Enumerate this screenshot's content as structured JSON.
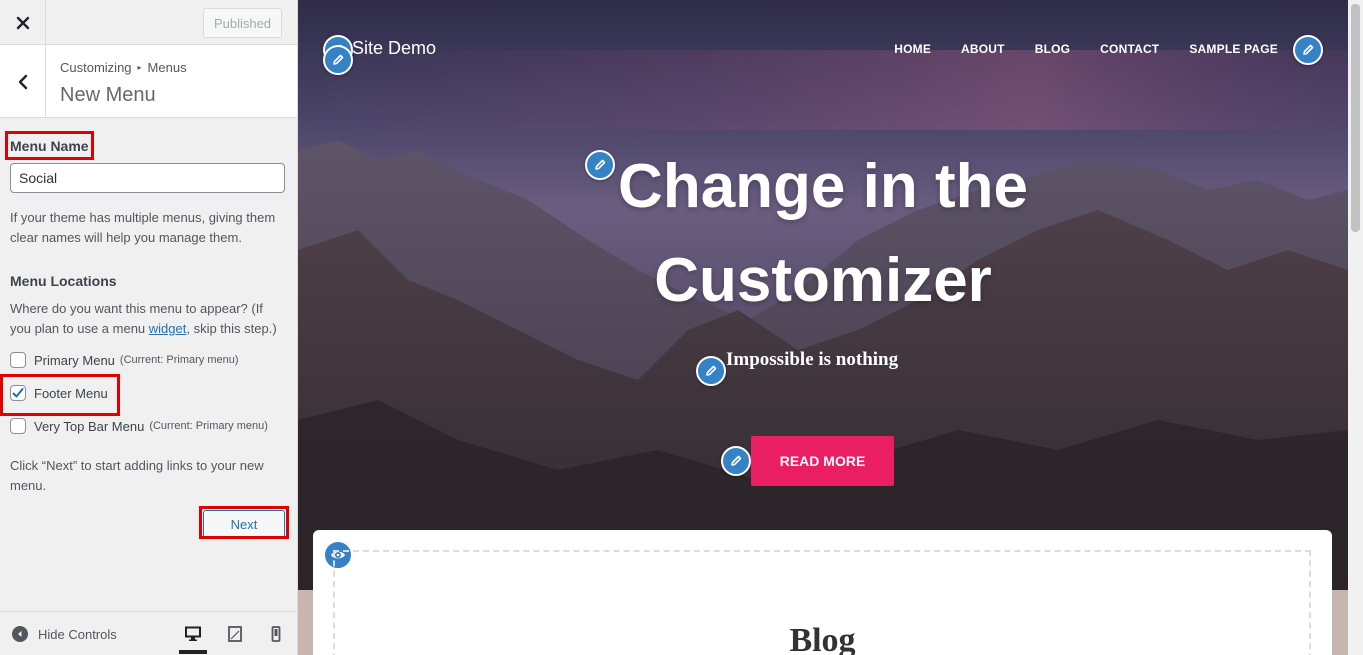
{
  "sidebar": {
    "published_label": "Published",
    "breadcrumb": {
      "root": "Customizing",
      "section": "Menus"
    },
    "panel_title": "New Menu",
    "menu_name": {
      "label": "Menu Name",
      "value": "Social",
      "description": "If your theme has multiple menus, giving them clear names will help you manage them."
    },
    "menu_locations": {
      "label": "Menu Locations",
      "description_before": "Where do you want this menu to appear? (If you plan to use a menu ",
      "description_link": "widget",
      "description_after": ", skip this step.)",
      "options": [
        {
          "label": "Primary Menu",
          "current": "(Current: Primary menu)",
          "checked": false
        },
        {
          "label": "Footer Menu",
          "current": "",
          "checked": true
        },
        {
          "label": "Very Top Bar Menu",
          "current": "(Current: Primary menu)",
          "checked": false
        }
      ]
    },
    "next_hint": "Click “Next” to start adding links to your new menu.",
    "next_label": "Next",
    "footer": {
      "hide_controls_label": "Hide Controls"
    }
  },
  "preview": {
    "site_title": "Site Demo",
    "nav": [
      "HOME",
      "ABOUT",
      "BLOG",
      "CONTACT",
      "SAMPLE PAGE"
    ],
    "hero_title_line1": "Change in the",
    "hero_title_line2": "Customizer",
    "hero_subtitle": "Impossible is nothing",
    "cta_label": "READ MORE",
    "blog_heading": "Blog"
  },
  "colors": {
    "highlight_red": "#e10000",
    "link_blue": "#2271b1",
    "edit_blue": "#3582c4",
    "cta_pink": "#e91e63"
  },
  "icons": [
    "close-icon",
    "chevron-left-icon",
    "checkmark-icon",
    "pencil-icon",
    "eye-icon",
    "desktop-icon",
    "tablet-icon",
    "mobile-icon",
    "hide-controls-icon"
  ]
}
